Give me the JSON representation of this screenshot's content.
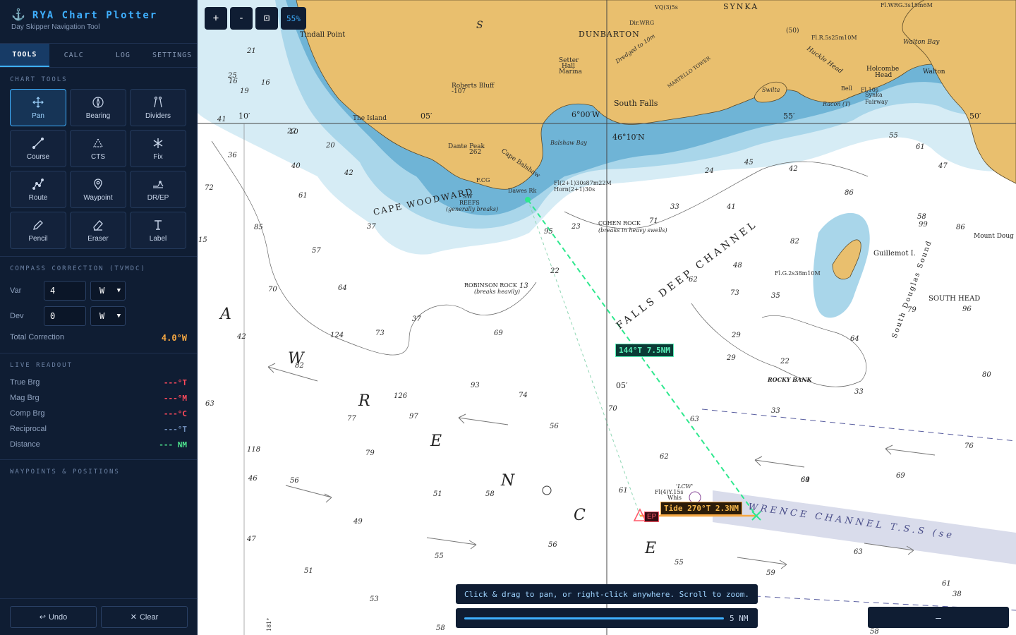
{
  "app": {
    "title": "RYA Chart Plotter",
    "subtitle": "Day Skipper Navigation Tool"
  },
  "tabs": [
    {
      "label": "TOOLS",
      "active": true
    },
    {
      "label": "CALC",
      "active": false
    },
    {
      "label": "LOG",
      "active": false
    },
    {
      "label": "SETTINGS",
      "active": false
    }
  ],
  "chart_tools": {
    "section_title": "CHART TOOLS",
    "tools": [
      {
        "label": "Pan",
        "icon": "pan-icon",
        "active": true
      },
      {
        "label": "Bearing",
        "icon": "compass-icon",
        "active": false
      },
      {
        "label": "Dividers",
        "icon": "dividers-icon",
        "active": false
      },
      {
        "label": "Course",
        "icon": "course-line-icon",
        "active": false
      },
      {
        "label": "CTS",
        "icon": "triangle-icon",
        "active": false
      },
      {
        "label": "Fix",
        "icon": "asterisk-icon",
        "active": false
      },
      {
        "label": "Route",
        "icon": "route-icon",
        "active": false
      },
      {
        "label": "Waypoint",
        "icon": "map-pin-icon",
        "active": false
      },
      {
        "label": "DR/EP",
        "icon": "dr-ep-icon",
        "active": false
      },
      {
        "label": "Pencil",
        "icon": "pencil-icon",
        "active": false
      },
      {
        "label": "Eraser",
        "icon": "eraser-icon",
        "active": false
      },
      {
        "label": "Label",
        "icon": "text-cursor-icon",
        "active": false
      }
    ]
  },
  "compass_correction": {
    "section_title": "COMPASS CORRECTION (TVMDC)",
    "var_label": "Var",
    "var_value": "4",
    "var_dir": "W",
    "dev_label": "Dev",
    "dev_value": "0",
    "dev_dir": "W",
    "total_label": "Total Correction",
    "total_value": "4.0°W"
  },
  "live_readout": {
    "section_title": "LIVE READOUT",
    "rows": [
      {
        "label": "True Brg",
        "value": "---°T",
        "color": "#ff4a5c"
      },
      {
        "label": "Mag Brg",
        "value": "---°M",
        "color": "#ff4a5c"
      },
      {
        "label": "Comp Brg",
        "value": "---°C",
        "color": "#ff4a5c"
      },
      {
        "label": "Reciprocal",
        "value": "---°T",
        "color": "#6f8cb8"
      },
      {
        "label": "Distance",
        "value": "--- NM",
        "color": "#4ee58e"
      }
    ]
  },
  "waypoints": {
    "section_title": "WAYPOINTS & POSITIONS"
  },
  "footer": {
    "undo_label": "Undo",
    "clear_label": "Clear"
  },
  "zoom": {
    "plus": "+",
    "minus": "-",
    "fit": "⊡",
    "level": "55%"
  },
  "hint_text": "Click & drag to pan, or right-click anywhere. Scroll to zoom.",
  "scale_label": "5 NM",
  "mini_panel_label": "–",
  "chart_overlay": {
    "course_label": "144°T 7.5NM",
    "tide_label": "Tide 270°T 2.3NM",
    "ep_label": "EP"
  },
  "chart_labels": {
    "tindall": "Tindall Point",
    "dunbarton": "DUNBARTON",
    "synka": "SYNKA",
    "setter": "Setter",
    "hall": "Hall",
    "marina": "Marina",
    "roberts": "Roberts Bluff",
    "roberts_h": "-107",
    "south_falls": "South Falls",
    "island": "The Island",
    "dante": "Dante Peak",
    "dante_h": "262",
    "cape_balshaw": "Cape Balshaw",
    "balshaw_bay": "Balshaw Bay",
    "cape_woodward": "CAPE WOODWARD",
    "sw_reefs": "SW",
    "reefs": "REEFS",
    "gen_breaks": "(generally breaks)",
    "dawes": "Dawes Rk",
    "cohen": "COHEN ROCK",
    "cohen_breaks": "(breaks in heavy swells)",
    "robinson": "ROBINSON ROCK",
    "robinson_breaks": "(breaks heavily)",
    "falls_deep": "FALLS DEEP CHANNEL",
    "guillemot": "Guillemot I.",
    "south_douglas": "South Douglas Sound",
    "south_head": "SOUTH HEAD",
    "rocky_bank": "ROCKY BANK",
    "holcombe": "Holcombe",
    "head": "Head",
    "walton": "Walton",
    "walton_bay": "Walton Bay",
    "huckle": "Huckle Head",
    "swilta": "Swilta",
    "mount_doug": "Mount Doug",
    "lat_46": "46°10′N",
    "lon_600": "6°00′W",
    "lon_05": "05′",
    "lon_55": "55′",
    "lon_50": "50′",
    "lat_10": "10′",
    "lat_05": "05′",
    "lawrence_channel": "WRENCE CHANNEL T.S.S (se",
    "st_lawrence_a": "A",
    "st_lawrence_w": "W",
    "st_lawrence_r": "R",
    "st_lawrence_e": "E",
    "st_lawrence_n": "N",
    "st_lawrence_c": "C",
    "st_lawrence_e2": "E",
    "light_dawes": "Fl(2+1)30s87m22M",
    "horn": "Horn(2+1)30s",
    "guillemot_lt": "Fl.G.2s38m10M",
    "lcw": "'LCW'",
    "lcw_lt": "Fl(4)Y.15s",
    "whis": "Whis",
    "racon": "Racon (T)",
    "synka_fw": "Synka",
    "fairway": "Fairway",
    "fl10s": "Fl.10s",
    "bell": "Bell",
    "s": "S",
    "dir_wrg": "Dir.WRG",
    "dredged": "Dredged to 10m",
    "martello": "MARTELLO TOWER",
    "fcg": "F.CG",
    "lat_181": "181°",
    "vq": "VQ(3)5s",
    "flr": "Fl.R.5s25m10M",
    "flwrg": "Fl.WRG.3s15m6M",
    "dsd": "(50)"
  },
  "soundings": [
    "21",
    "25",
    "16",
    "16",
    "19",
    "10",
    "41",
    "22",
    "20",
    "36",
    "40",
    "42",
    "72",
    "61",
    "85",
    "37",
    "57",
    "15",
    "70",
    "64",
    "42",
    "124",
    "73",
    "37",
    "69",
    "82",
    "126",
    "93",
    "74",
    "97",
    "63",
    "77",
    "56",
    "118",
    "79",
    "46",
    "56",
    "49",
    "47",
    "51",
    "53",
    "55",
    "51",
    "58",
    "56",
    "58",
    "55",
    "61",
    "63",
    "62",
    "33",
    "62",
    "69",
    "73",
    "29",
    "29",
    "22",
    "33",
    "64",
    "35",
    "71",
    "48",
    "82",
    "86",
    "99",
    "80",
    "76",
    "69",
    "64",
    "63",
    "59",
    "61",
    "58",
    "38",
    "41",
    "33",
    "24",
    "45",
    "42",
    "58",
    "86",
    "55",
    "61",
    "47",
    "96",
    "79",
    "95",
    "23",
    "22",
    "13",
    "70"
  ]
}
